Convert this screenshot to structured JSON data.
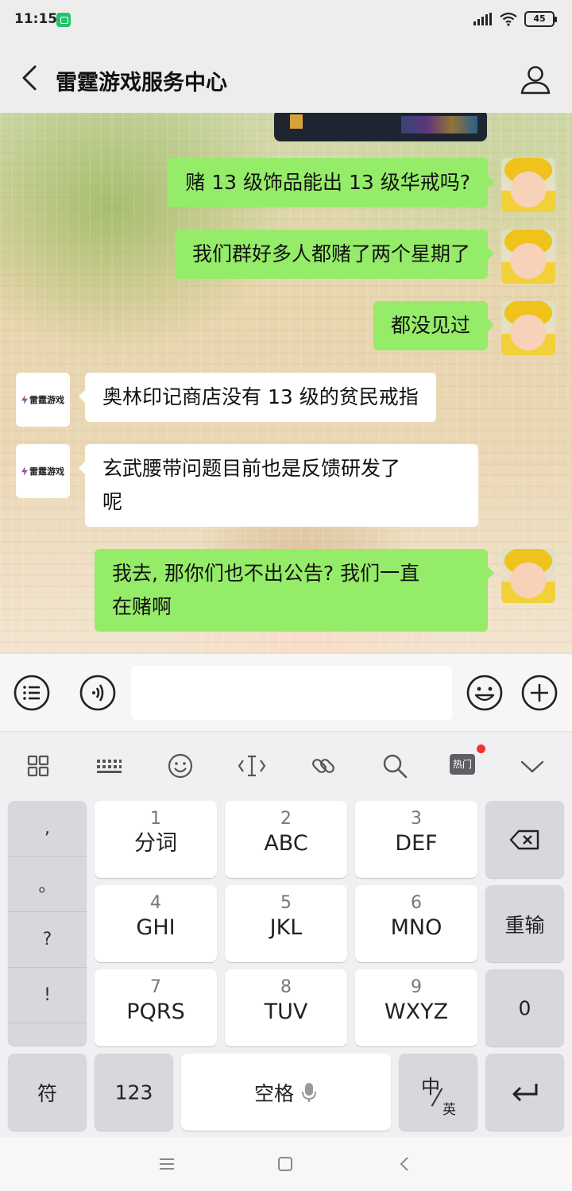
{
  "status": {
    "time": "11:15",
    "battery": "45"
  },
  "header": {
    "title": "雷霆游戏服务中心"
  },
  "bot": {
    "logo_text": "雷霆游戏"
  },
  "messages": [
    {
      "side": "me",
      "lines": [
        "赌 13 级饰品能出 13 级华戒吗?"
      ]
    },
    {
      "side": "me",
      "lines": [
        "我们群好多人都赌了两个星期了"
      ]
    },
    {
      "side": "me",
      "lines": [
        "都没见过"
      ]
    },
    {
      "side": "them",
      "lines": [
        "奥林印记商店没有 13 级的贫民戒指"
      ]
    },
    {
      "side": "them",
      "lines": [
        "玄武腰带问题目前也是反馈研发了",
        "呢"
      ]
    },
    {
      "side": "me",
      "lines": [
        "我去, 那你们也不出公告? 我们一直",
        "在赌啊"
      ]
    }
  ],
  "keyboard": {
    "toolbar": {
      "hot": "热门"
    },
    "punct": [
      ",",
      "。",
      "?",
      "!"
    ],
    "keys": [
      {
        "num": "1",
        "label": "分词"
      },
      {
        "num": "2",
        "label": "ABC"
      },
      {
        "num": "3",
        "label": "DEF"
      },
      {
        "num": "4",
        "label": "GHI"
      },
      {
        "num": "5",
        "label": "JKL"
      },
      {
        "num": "6",
        "label": "MNO"
      },
      {
        "num": "7",
        "label": "PQRS"
      },
      {
        "num": "8",
        "label": "TUV"
      },
      {
        "num": "9",
        "label": "WXYZ"
      }
    ],
    "reenter": "重输",
    "zero": "0",
    "symbol": "符",
    "numbers": "123",
    "space": "空格",
    "lang_main": "中",
    "lang_sub": "英"
  }
}
